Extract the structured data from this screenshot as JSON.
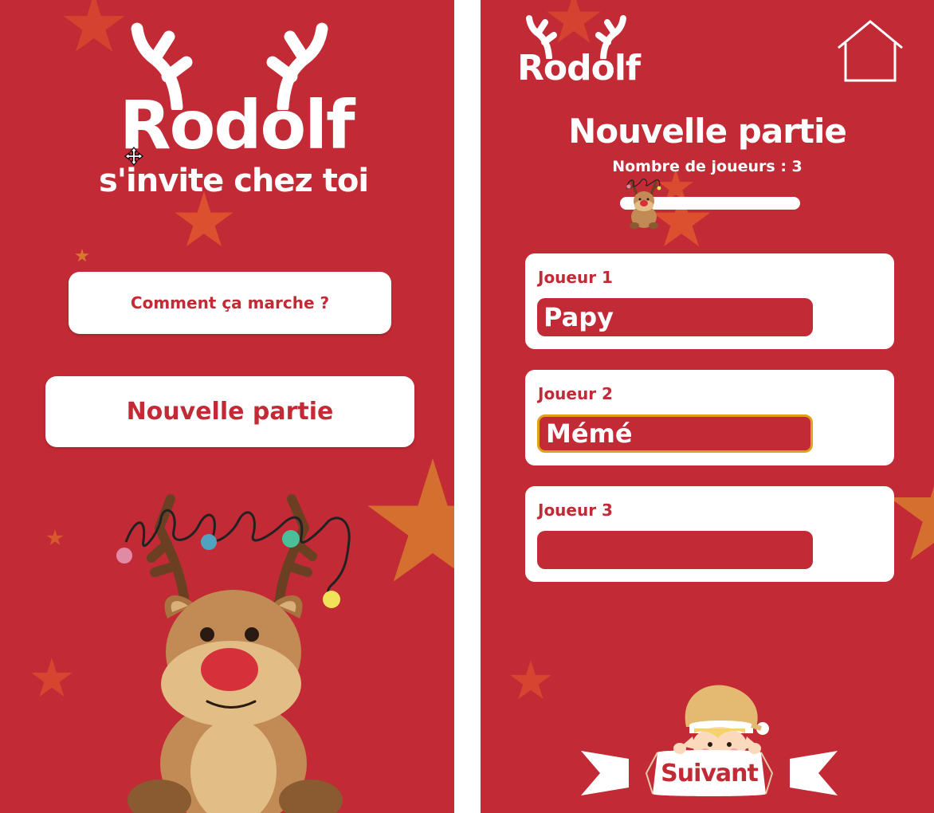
{
  "left_screen": {
    "logo": {
      "title": "Rodolf",
      "subtitle": "s'invite chez toi"
    },
    "how_it_works_label": "Comment ça marche ?",
    "new_game_label": "Nouvelle partie"
  },
  "right_screen": {
    "logo": {
      "title": "Rodolf"
    },
    "page_title": "Nouvelle partie",
    "players_count_label": "Nombre de joueurs : 3",
    "players_slider": {
      "value": 3,
      "min": 1,
      "max": 10
    },
    "players": [
      {
        "label": "Joueur 1",
        "value": "Papy"
      },
      {
        "label": "Joueur 2",
        "value": "Mémé"
      },
      {
        "label": "Joueur 3",
        "value": ""
      }
    ],
    "next_label": "Suivant"
  },
  "icons": [
    "home-icon",
    "move-cursor-icon",
    "reindeer-mascot",
    "elf-mascot",
    "star-decor"
  ],
  "colors": {
    "background": "#c22a35",
    "card": "#ffffff",
    "accent_text": "#c22a35",
    "star": "#e05a2f",
    "focus_border": "#e0a21c",
    "ribbon": "#f2e2cf"
  }
}
